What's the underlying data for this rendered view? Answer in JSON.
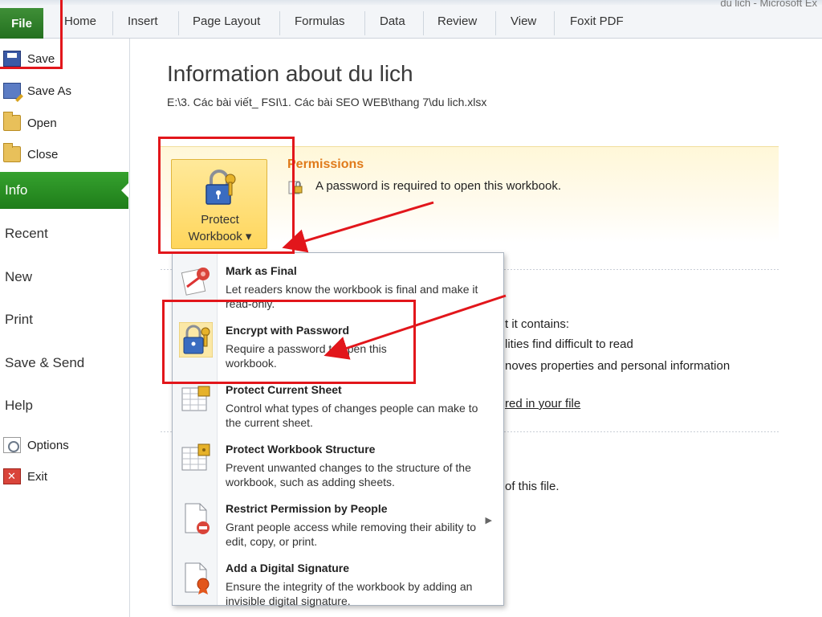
{
  "ribbon": {
    "file_tab": "File",
    "tabs": [
      "Home",
      "Insert",
      "Page Layout",
      "Formulas",
      "Data",
      "Review",
      "View",
      "Foxit PDF"
    ],
    "window_title_fragment": "du lich - Microsoft Ex"
  },
  "backstage": {
    "commands": [
      {
        "label": "Save",
        "icon": "save-icon"
      },
      {
        "label": "Save As",
        "icon": "save-as-icon"
      },
      {
        "label": "Open",
        "icon": "open-folder-icon"
      },
      {
        "label": "Close",
        "icon": "close-folder-icon"
      }
    ],
    "tabs": [
      "Info",
      "Recent",
      "New",
      "Print",
      "Save & Send",
      "Help"
    ],
    "active_tab": "Info",
    "bottom_commands": [
      {
        "label": "Options",
        "icon": "options-icon"
      },
      {
        "label": "Exit",
        "icon": "exit-icon"
      }
    ]
  },
  "info": {
    "title": "Information about du lich",
    "path": "E:\\3. Các bài viết_ FSI\\1. Các bài SEO WEB\\thang 7\\du lich.xlsx",
    "permissions": {
      "title": "Permissions",
      "text": "A password is required to open this workbook."
    },
    "protect_button": {
      "line1": "Protect",
      "line2": "Workbook ▾"
    },
    "background_fragments": {
      "prepare_1": "t it contains:",
      "prepare_2": "lities find difficult to read",
      "prepare_3": "noves properties and personal information",
      "prepare_link": "red in your file",
      "versions": "of this file."
    }
  },
  "protect_menu": {
    "items": [
      {
        "title": "Mark as Final",
        "desc": "Let readers know the workbook is final and make it read-only.",
        "icon": "mark-final-icon"
      },
      {
        "title": "Encrypt with Password",
        "desc": "Require a password to open this workbook.",
        "icon": "lock-key-icon"
      },
      {
        "title": "Protect Current Sheet",
        "desc": "Control what types of changes people can make to the current sheet.",
        "icon": "protect-sheet-icon"
      },
      {
        "title": "Protect Workbook Structure",
        "desc": "Prevent unwanted changes to the structure of the workbook, such as adding sheets.",
        "icon": "protect-structure-icon"
      },
      {
        "title": "Restrict Permission by People",
        "desc": "Grant people access while removing their ability to edit, copy, or print.",
        "icon": "restrict-permission-icon"
      },
      {
        "title": "Add a Digital Signature",
        "desc": "Ensure the integrity of the workbook by adding an invisible digital signature.",
        "icon": "digital-signature-icon"
      }
    ]
  },
  "colors": {
    "file_tab": "#2e7d28",
    "active_nav": "#2a9224",
    "permissions_title": "#e07a1a",
    "annotation_red": "#e2161b"
  }
}
